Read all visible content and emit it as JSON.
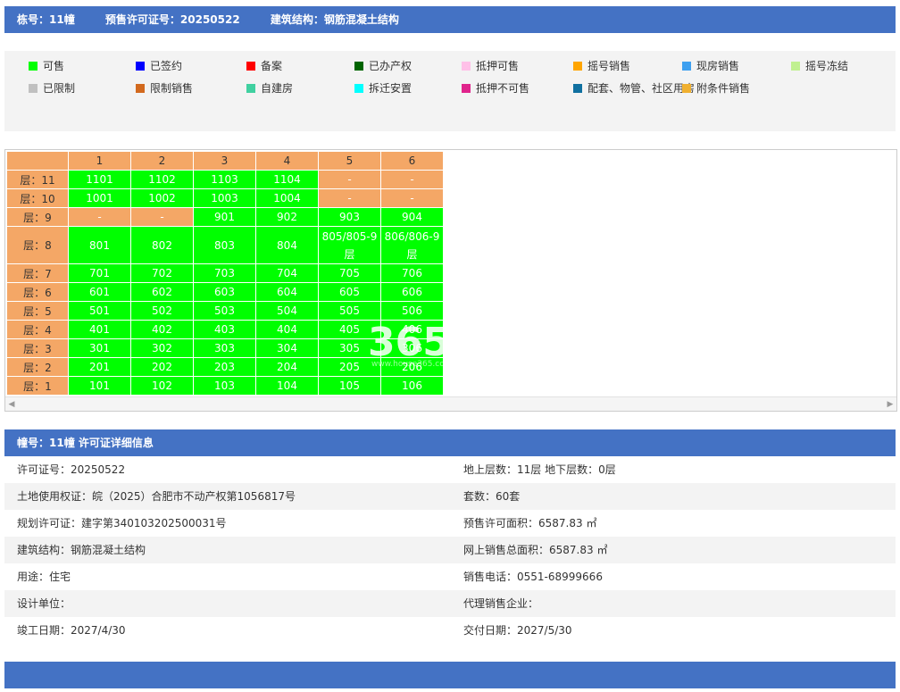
{
  "header": {
    "building": "栋号：11幢",
    "permit": "预售许可证号：20250522",
    "structure": "建筑结构：钢筋混凝土结构"
  },
  "legend": [
    {
      "label": "可售",
      "color": "#00ff00"
    },
    {
      "label": "已签约",
      "color": "#0000ff"
    },
    {
      "label": "备案",
      "color": "#ff0000"
    },
    {
      "label": "已办产权",
      "color": "#006400"
    },
    {
      "label": "抵押可售",
      "color": "#ffc0e8"
    },
    {
      "label": "摇号销售",
      "color": "#ffa500"
    },
    {
      "label": "现房销售",
      "color": "#3ea0f0"
    },
    {
      "label": "摇号冻结",
      "color": "#c0f090"
    },
    {
      "label": "已限制",
      "color": "#c0c0c0"
    },
    {
      "label": "限制销售",
      "color": "#d2691e"
    },
    {
      "label": "自建房",
      "color": "#40d0a0"
    },
    {
      "label": "拆迁安置",
      "color": "#00ffff"
    },
    {
      "label": "抵押不可售",
      "color": "#e0248c"
    },
    {
      "label": "配套、物管、社区用房",
      "color": "#1070a0"
    },
    {
      "label": "附条件销售",
      "color": "#f0b030"
    }
  ],
  "grid": {
    "columns": [
      "1",
      "2",
      "3",
      "4",
      "5",
      "6"
    ],
    "rows": [
      {
        "floor": "层：11",
        "units": [
          "1101",
          "1102",
          "1103",
          "1104",
          "-",
          "-"
        ]
      },
      {
        "floor": "层：10",
        "units": [
          "1001",
          "1002",
          "1003",
          "1004",
          "-",
          "-"
        ]
      },
      {
        "floor": "层：9",
        "units": [
          "-",
          "-",
          "901",
          "902",
          "903",
          "904"
        ]
      },
      {
        "floor": "层：8",
        "units": [
          "801",
          "802",
          "803",
          "804",
          "805/805-9层",
          "806/806-9层"
        ]
      },
      {
        "floor": "层：7",
        "units": [
          "701",
          "702",
          "703",
          "704",
          "705",
          "706"
        ]
      },
      {
        "floor": "层：6",
        "units": [
          "601",
          "602",
          "603",
          "604",
          "605",
          "606"
        ]
      },
      {
        "floor": "层：5",
        "units": [
          "501",
          "502",
          "503",
          "504",
          "505",
          "506"
        ]
      },
      {
        "floor": "层：4",
        "units": [
          "401",
          "402",
          "403",
          "404",
          "405",
          "406"
        ]
      },
      {
        "floor": "层：3",
        "units": [
          "301",
          "302",
          "303",
          "304",
          "305",
          "306"
        ]
      },
      {
        "floor": "层：2",
        "units": [
          "201",
          "202",
          "203",
          "204",
          "205",
          "206"
        ]
      },
      {
        "floor": "层：1",
        "units": [
          "101",
          "102",
          "103",
          "104",
          "105",
          "106"
        ]
      }
    ],
    "watermark": "365",
    "watermark_url": "www.house365.com"
  },
  "detail": {
    "title": "幢号：11幢 许可证详细信息",
    "rows": [
      [
        "许可证号：20250522",
        "地上层数：11层  地下层数：0层"
      ],
      [
        "土地使用权证：皖（2025）合肥市不动产权第1056817号",
        "套数：60套"
      ],
      [
        "规划许可证：建字第340103202500031号",
        "预售许可面积：6587.83 ㎡"
      ],
      [
        "建筑结构：钢筋混凝土结构",
        "网上销售总面积：6587.83 ㎡"
      ],
      [
        "用途：住宅",
        "销售电话：0551-68999666"
      ],
      [
        "设计单位：",
        "代理销售企业："
      ],
      [
        "竣工日期：2027/4/30",
        "交付日期：2027/5/30"
      ]
    ]
  }
}
